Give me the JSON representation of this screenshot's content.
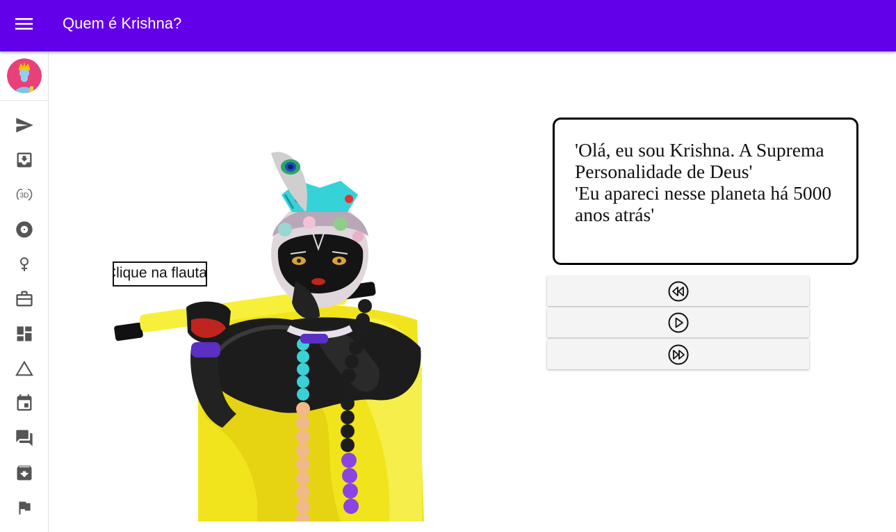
{
  "appbar": {
    "title": "Quem é Krishna?",
    "menu_icon": "hamburger-menu-icon",
    "background": "#6200ea"
  },
  "sidebar": {
    "avatar": "krishna-avatar",
    "items": [
      {
        "icon": "send-icon"
      },
      {
        "icon": "move-to-inbox-icon"
      },
      {
        "icon": "3d-rotation-icon"
      },
      {
        "icon": "album-icon"
      },
      {
        "icon": "female-icon"
      },
      {
        "icon": "work-briefcase-icon"
      },
      {
        "icon": "dashboard-icon"
      },
      {
        "icon": "change-history-icon"
      },
      {
        "icon": "event-calendar-icon"
      },
      {
        "icon": "forum-icon"
      },
      {
        "icon": "archive-icon"
      },
      {
        "icon": "flag-icon"
      }
    ]
  },
  "scene": {
    "flute_label": "Clique na flauta"
  },
  "dialog": {
    "line1": "'Olá, eu sou Krishna. A Suprema Personalidade de Deus'",
    "line2": "'Eu apareci nesse planeta há 5000 anos atrás'"
  },
  "controls": [
    {
      "icon": "fast-rewind-icon"
    },
    {
      "icon": "play-icon"
    },
    {
      "icon": "fast-forward-icon"
    }
  ]
}
